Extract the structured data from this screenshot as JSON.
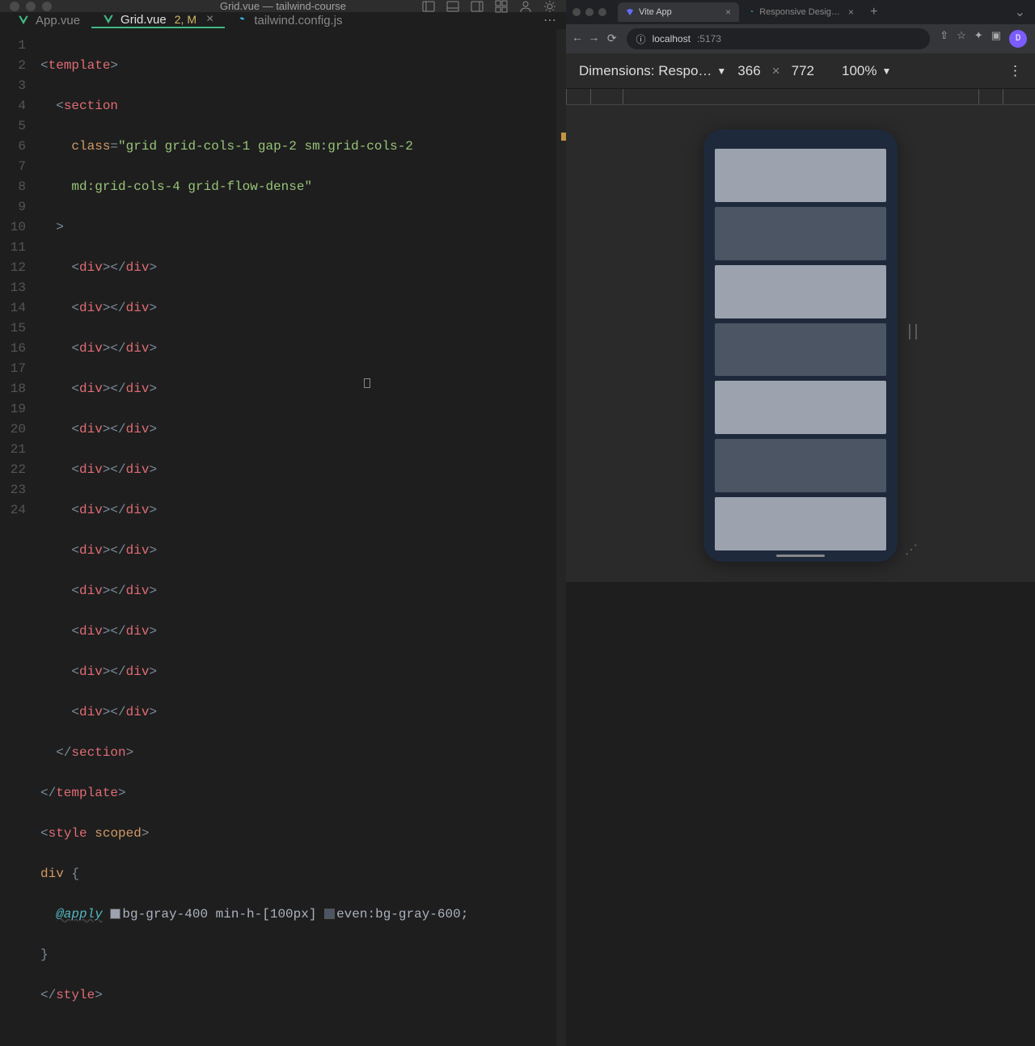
{
  "titlebar": {
    "title": "Grid.vue — tailwind-course"
  },
  "tabs": {
    "app": {
      "label": "App.vue"
    },
    "grid": {
      "label": "Grid.vue",
      "status": "2, M"
    },
    "config": {
      "label": "tailwind.config.js"
    }
  },
  "code": {
    "line1": {
      "p1": "<",
      "tag": "template",
      "p2": ">"
    },
    "line2": {
      "p1": "<",
      "tag": "section"
    },
    "line3": {
      "attr": "class",
      "p1": "=",
      "q": "\"",
      "val1": "grid grid-cols-1 gap-2 sm:grid-cols-2"
    },
    "line3b": {
      "val2": "md:grid-cols-4 grid-flow-dense",
      "q": "\""
    },
    "line4": {
      "p1": ">"
    },
    "div_open": {
      "p1": "<",
      "tag": "div",
      "p2": "></",
      "tag2": "div",
      "p3": ">"
    },
    "line17": {
      "p1": "</",
      "tag": "section",
      "p2": ">"
    },
    "line18": {
      "p1": "</",
      "tag": "template",
      "p2": ">"
    },
    "line19": {
      "p1": "<",
      "tag": "style",
      "attr": "scoped",
      "p2": ">"
    },
    "line20": {
      "sel": "div",
      "brace": " {"
    },
    "line21": {
      "apply": "@apply",
      "cls1": "bg-gray-400 min-h-[100px]",
      "cls2": "even:bg-gray-600;"
    },
    "line22": {
      "brace": "}"
    },
    "line23": {
      "p1": "</",
      "tag": "style",
      "p2": ">"
    },
    "ln": [
      "1",
      "2",
      "3",
      "",
      "4",
      "5",
      "6",
      "7",
      "8",
      "9",
      "10",
      "11",
      "12",
      "13",
      "14",
      "15",
      "16",
      "17",
      "18",
      "19",
      "20",
      "21",
      "22",
      "23",
      "24"
    ]
  },
  "browser": {
    "tab1": "Vite App",
    "tab2": "Responsive Design - Tailwind",
    "url_host": "localhost",
    "url_port": ":5173",
    "avatar": "D"
  },
  "devtools": {
    "dimensions_label": "Dimensions: Respo…",
    "width": "366",
    "times": "×",
    "height": "772",
    "zoom": "100%"
  },
  "chart_data": null
}
